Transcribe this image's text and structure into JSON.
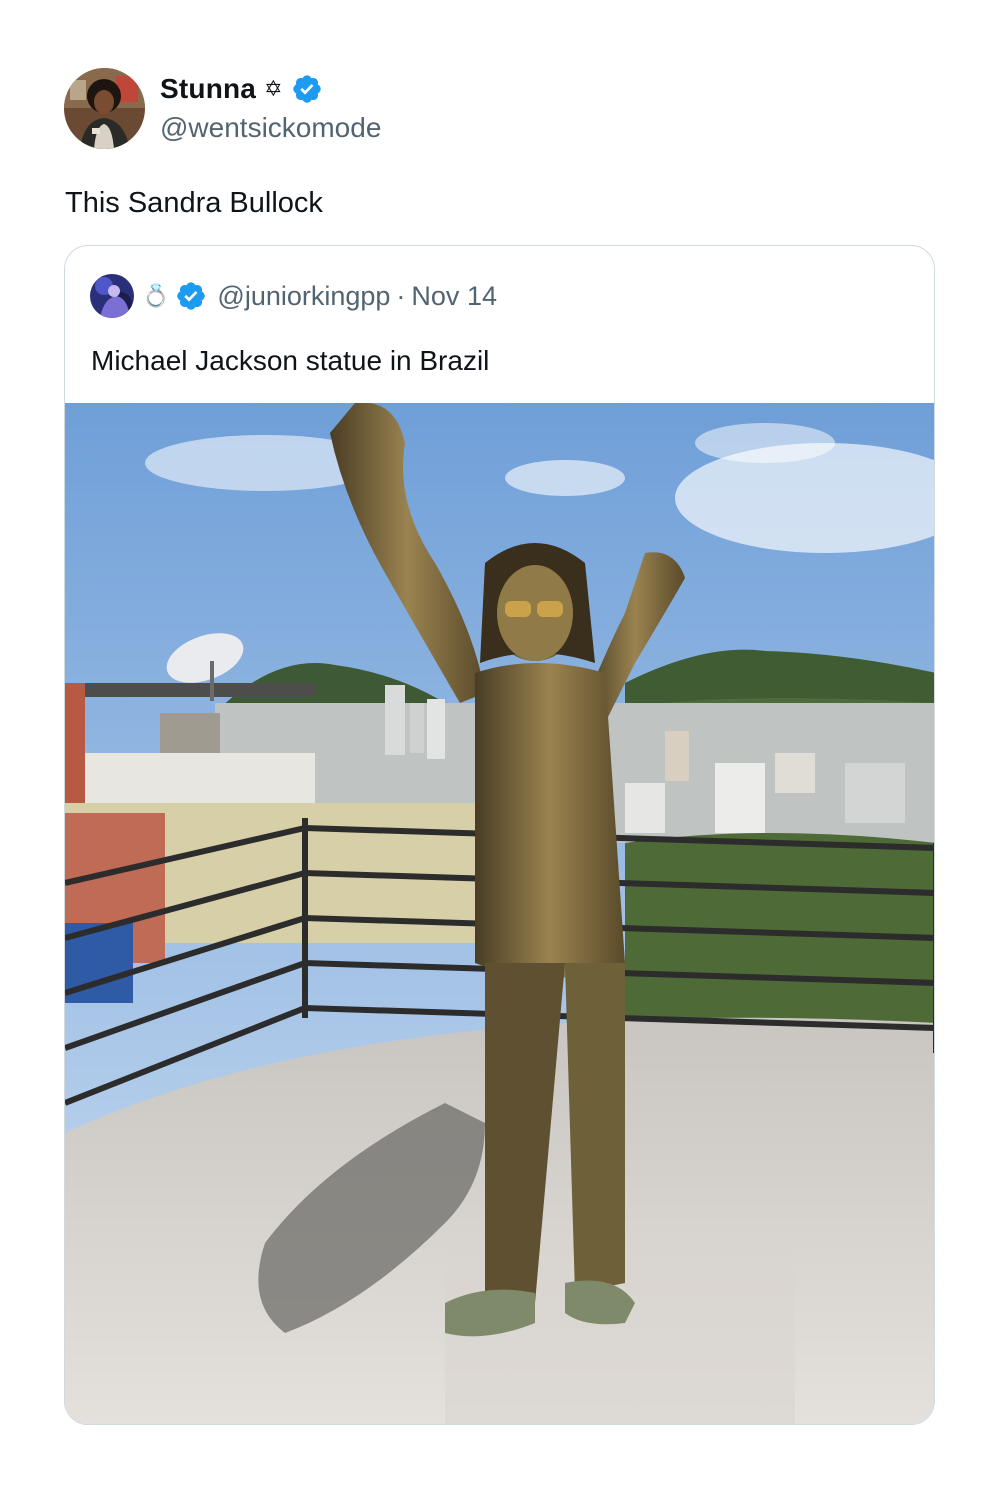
{
  "author": {
    "display_name": "Stunna",
    "name_emoji": "✡",
    "verified": true,
    "handle": "@wentsickomode"
  },
  "tweet": {
    "text": "This Sandra Bullock"
  },
  "quoted_tweet": {
    "name_emoji": "💍",
    "verified": true,
    "handle": "@juniorkingpp",
    "separator": "·",
    "date": "Nov 14",
    "text": "Michael Jackson statue in Brazil",
    "image": "bronze-statue-photo"
  },
  "colors": {
    "verified_badge": "#1d9bf0",
    "secondary_text": "#536471",
    "border": "#cfd9de"
  }
}
